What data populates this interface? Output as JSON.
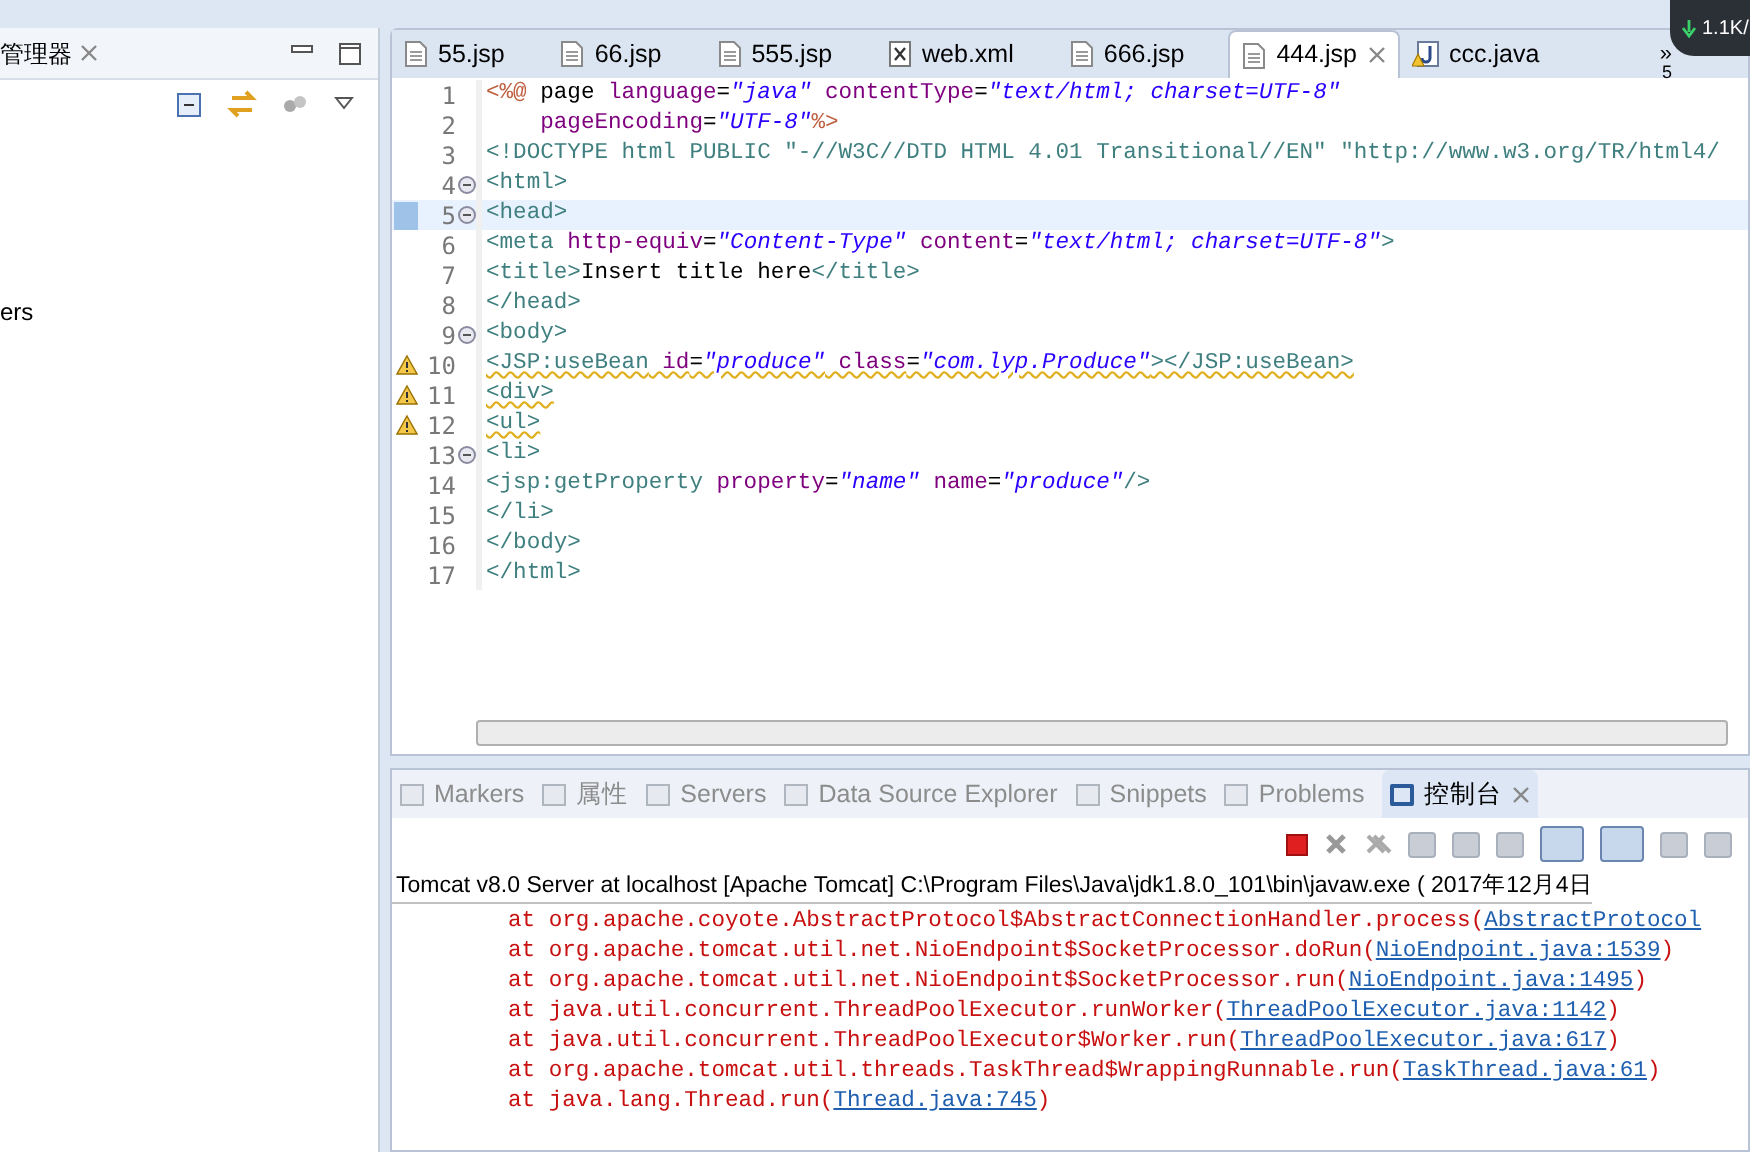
{
  "explorer": {
    "title": "管理器",
    "tree_items": [
      {
        "label": "ers"
      }
    ]
  },
  "editor_tabs": [
    {
      "label": "55.jsp",
      "kind": "jsp",
      "selected": false
    },
    {
      "label": "66.jsp",
      "kind": "jsp",
      "selected": false
    },
    {
      "label": "555.jsp",
      "kind": "jsp",
      "selected": false
    },
    {
      "label": "web.xml",
      "kind": "xml",
      "selected": false
    },
    {
      "label": "666.jsp",
      "kind": "jsp",
      "selected": false
    },
    {
      "label": "444.jsp",
      "kind": "jsp",
      "selected": true
    },
    {
      "label": "ccc.java",
      "kind": "java",
      "selected": false
    }
  ],
  "tab_overflow": {
    "icon": "»",
    "count": "5"
  },
  "network_widget": {
    "text": "1.1K/"
  },
  "code_lines": [
    {
      "number": "1",
      "warning": false,
      "fold": false,
      "current": false,
      "tokens": [
        {
          "kind": "directive",
          "text": "<%@"
        },
        {
          "kind": "plain",
          "text": " page "
        },
        {
          "kind": "attr",
          "text": "language"
        },
        {
          "kind": "plain",
          "text": "="
        },
        {
          "kind": "value",
          "text": "\"java\""
        },
        {
          "kind": "attr",
          "text": " contentType"
        },
        {
          "kind": "plain",
          "text": "="
        },
        {
          "kind": "value",
          "text": "\"text/html; charset=UTF-8\""
        }
      ]
    },
    {
      "number": "2",
      "warning": false,
      "fold": false,
      "current": false,
      "tokens": [
        {
          "kind": "attr",
          "text": "    pageEncoding"
        },
        {
          "kind": "plain",
          "text": "="
        },
        {
          "kind": "value",
          "text": "\"UTF-8\""
        },
        {
          "kind": "directive",
          "text": "%>"
        }
      ]
    },
    {
      "number": "3",
      "warning": false,
      "fold": false,
      "current": false,
      "tokens": [
        {
          "kind": "doctype",
          "text": "<!DOCTYPE html PUBLIC \"-//W3C//DTD HTML 4.01 Transitional//EN\" \"http://www.w3.org/TR/html4/"
        }
      ]
    },
    {
      "number": "4",
      "warning": false,
      "fold": true,
      "current": false,
      "tokens": [
        {
          "kind": "tag",
          "text": "<html>"
        }
      ]
    },
    {
      "number": "5",
      "warning": false,
      "fold": true,
      "current": true,
      "tokens": [
        {
          "kind": "tag",
          "text": "<head>"
        }
      ]
    },
    {
      "number": "6",
      "warning": false,
      "fold": false,
      "current": false,
      "tokens": [
        {
          "kind": "tag",
          "text": "<meta"
        },
        {
          "kind": "attr",
          "text": " http-equiv"
        },
        {
          "kind": "plain",
          "text": "="
        },
        {
          "kind": "value",
          "text": "\"Content-Type\""
        },
        {
          "kind": "attr",
          "text": " content"
        },
        {
          "kind": "plain",
          "text": "="
        },
        {
          "kind": "value",
          "text": "\"text/html; charset=UTF-8\""
        },
        {
          "kind": "tag",
          "text": ">"
        }
      ]
    },
    {
      "number": "7",
      "warning": false,
      "fold": false,
      "current": false,
      "tokens": [
        {
          "kind": "tag",
          "text": "<title>"
        },
        {
          "kind": "plain",
          "text": "Insert title here"
        },
        {
          "kind": "tag",
          "text": "</title>"
        }
      ]
    },
    {
      "number": "8",
      "warning": false,
      "fold": false,
      "current": false,
      "tokens": [
        {
          "kind": "tag",
          "text": "</head>"
        }
      ]
    },
    {
      "number": "9",
      "warning": false,
      "fold": true,
      "current": false,
      "tokens": [
        {
          "kind": "tag",
          "text": "<body>"
        }
      ]
    },
    {
      "number": "10",
      "warning": true,
      "fold": false,
      "current": false,
      "tokens": [
        {
          "kind": "tag",
          "text": "<JSP:useBean"
        },
        {
          "kind": "attr",
          "text": " id"
        },
        {
          "kind": "plain",
          "text": "="
        },
        {
          "kind": "value",
          "text": "\"produce\""
        },
        {
          "kind": "attr",
          "text": " class"
        },
        {
          "kind": "plain",
          "text": "="
        },
        {
          "kind": "value",
          "text": "\"com.lyp.Produce\""
        },
        {
          "kind": "tag",
          "text": "></JSP:useBean>"
        }
      ]
    },
    {
      "number": "11",
      "warning": true,
      "fold": false,
      "current": false,
      "tokens": [
        {
          "kind": "tag",
          "text": "<div>"
        }
      ]
    },
    {
      "number": "12",
      "warning": true,
      "fold": false,
      "current": false,
      "tokens": [
        {
          "kind": "tag",
          "text": "<ul>"
        }
      ]
    },
    {
      "number": "13",
      "warning": false,
      "fold": true,
      "current": false,
      "tokens": [
        {
          "kind": "tag",
          "text": "<li>"
        }
      ]
    },
    {
      "number": "14",
      "warning": false,
      "fold": false,
      "current": false,
      "tokens": [
        {
          "kind": "tag",
          "text": "<jsp:getProperty"
        },
        {
          "kind": "attr",
          "text": " property"
        },
        {
          "kind": "plain",
          "text": "="
        },
        {
          "kind": "value",
          "text": "\"name\""
        },
        {
          "kind": "attr",
          "text": " name"
        },
        {
          "kind": "plain",
          "text": "="
        },
        {
          "kind": "value",
          "text": "\"produce\""
        },
        {
          "kind": "tag",
          "text": "/>"
        }
      ]
    },
    {
      "number": "15",
      "warning": false,
      "fold": false,
      "current": false,
      "tokens": [
        {
          "kind": "tag",
          "text": "</li>"
        }
      ]
    },
    {
      "number": "16",
      "warning": false,
      "fold": false,
      "current": false,
      "tokens": [
        {
          "kind": "tag",
          "text": "</body>"
        }
      ]
    },
    {
      "number": "17",
      "warning": false,
      "fold": false,
      "current": false,
      "tokens": [
        {
          "kind": "tag",
          "text": "</html>"
        }
      ]
    }
  ],
  "bottom_tabs": [
    {
      "label": "Markers",
      "selected": false
    },
    {
      "label": "属性",
      "selected": false
    },
    {
      "label": "Servers",
      "selected": false
    },
    {
      "label": "Data Source Explorer",
      "selected": false
    },
    {
      "label": "Snippets",
      "selected": false
    },
    {
      "label": "Problems",
      "selected": false
    },
    {
      "label": "控制台",
      "selected": true
    }
  ],
  "console": {
    "title": "Tomcat v8.0 Server at localhost [Apache Tomcat] C:\\Program Files\\Java\\jdk1.8.0_101\\bin\\javaw.exe ( 2017年12月4日",
    "lines": [
      {
        "text": "at org.apache.coyote.AbstractProtocol$AbstractConnectionHandler.process(",
        "link": "AbstractProtocol"
      },
      {
        "text": "at org.apache.tomcat.util.net.NioEndpoint$SocketProcessor.doRun(",
        "link": "NioEndpoint.java:1539",
        "suffix": ")"
      },
      {
        "text": "at org.apache.tomcat.util.net.NioEndpoint$SocketProcessor.run(",
        "link": "NioEndpoint.java:1495",
        "suffix": ")"
      },
      {
        "text": "at java.util.concurrent.ThreadPoolExecutor.runWorker(",
        "link": "ThreadPoolExecutor.java:1142",
        "suffix": ")"
      },
      {
        "text": "at java.util.concurrent.ThreadPoolExecutor$Worker.run(",
        "link": "ThreadPoolExecutor.java:617",
        "suffix": ")"
      },
      {
        "text": "at org.apache.tomcat.util.threads.TaskThread$WrappingRunnable.run(",
        "link": "TaskThread.java:61",
        "suffix": ")"
      },
      {
        "text": "at java.lang.Thread.run(",
        "link": "Thread.java:745",
        "suffix": ")"
      }
    ]
  }
}
